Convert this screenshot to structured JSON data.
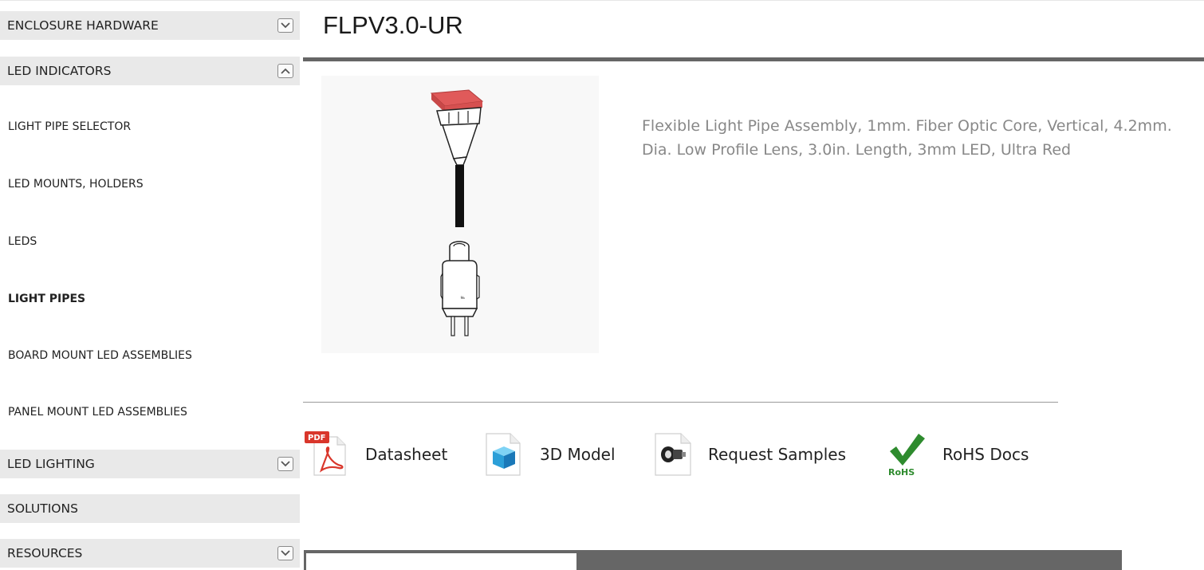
{
  "sidebar": {
    "categories": [
      {
        "label": "ENCLOSURE HARDWARE",
        "toggle": "chevron-down"
      },
      {
        "label": "LED INDICATORS",
        "toggle": "chevron-up"
      },
      {
        "label": "LED LIGHTING",
        "toggle": "chevron-down"
      },
      {
        "label": "SOLUTIONS",
        "toggle": ""
      },
      {
        "label": "RESOURCES",
        "toggle": "chevron-down"
      }
    ],
    "subitems": [
      {
        "label": "LIGHT PIPE SELECTOR",
        "active": false
      },
      {
        "label": "LED MOUNTS, HOLDERS",
        "active": false
      },
      {
        "label": "LEDS",
        "active": false
      },
      {
        "label": "LIGHT PIPES",
        "active": true
      },
      {
        "label": "BOARD MOUNT LED ASSEMBLIES",
        "active": false
      },
      {
        "label": "PANEL MOUNT LED ASSEMBLIES",
        "active": false
      }
    ]
  },
  "product": {
    "title": "FLPV3.0-UR",
    "description": "Flexible Light Pipe Assembly, 1mm. Fiber Optic Core, Vertical, 4.2mm. Dia. Low Profile Lens, 3.0in. Length, 3mm LED, Ultra Red",
    "lens_color": "#e05a5a"
  },
  "documents": [
    {
      "label": "Datasheet",
      "icon": "pdf-icon",
      "badge": "PDF"
    },
    {
      "label": "3D Model",
      "icon": "3d-model-icon"
    },
    {
      "label": "Request Samples",
      "icon": "samples-icon"
    },
    {
      "label": "RoHS Docs",
      "icon": "rohs-icon",
      "badge": "RoHS"
    }
  ],
  "colors": {
    "sidebar_bg": "#e9e9e9",
    "rule": "#666666",
    "description_text": "#888888",
    "pdf_red": "#d9362b",
    "rohs_green": "#2e8b2e"
  }
}
